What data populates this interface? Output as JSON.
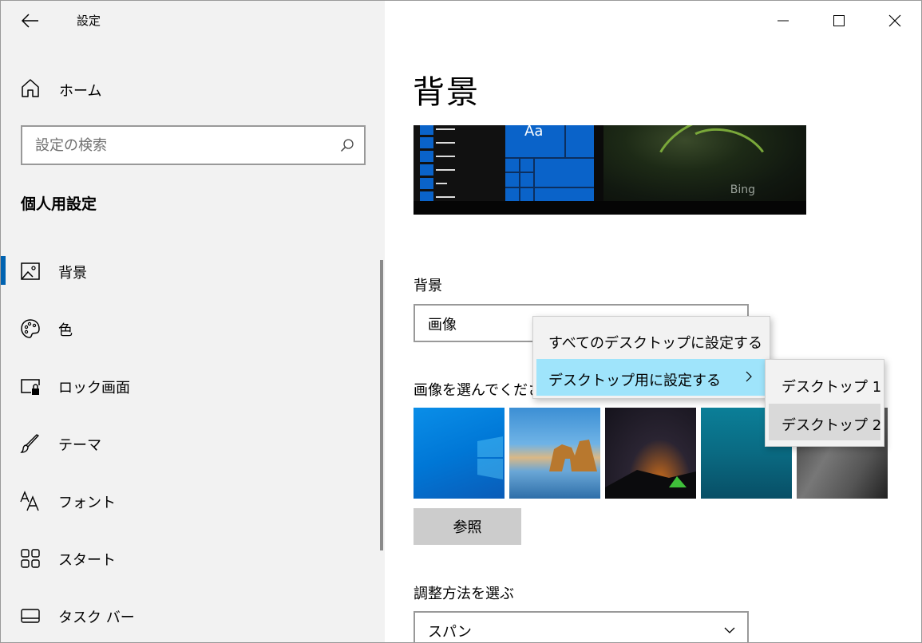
{
  "window": {
    "app_title": "設定"
  },
  "sidebar": {
    "home_label": "ホーム",
    "search_placeholder": "設定の検索",
    "section_heading": "個人用設定",
    "items": [
      {
        "label": "背景",
        "icon": "picture-icon",
        "selected": true
      },
      {
        "label": "色",
        "icon": "palette-icon",
        "selected": false
      },
      {
        "label": "ロック画面",
        "icon": "lock-screen-icon",
        "selected": false
      },
      {
        "label": "テーマ",
        "icon": "brush-icon",
        "selected": false
      },
      {
        "label": "フォント",
        "icon": "font-icon",
        "selected": false
      },
      {
        "label": "スタート",
        "icon": "start-grid-icon",
        "selected": false
      },
      {
        "label": "タスク バー",
        "icon": "taskbar-icon",
        "selected": false
      }
    ]
  },
  "main": {
    "page_title": "背景",
    "preview": {
      "sample_text": "Aa",
      "watermark": "Bing"
    },
    "background_label": "背景",
    "background_value": "画像",
    "choose_image_label": "画像を選んでくださ",
    "browse_label": "参照",
    "fit_label": "調整方法を選ぶ",
    "fit_value": "スパン"
  },
  "context_menu": {
    "items": [
      {
        "label": "すべてのデスクトップに設定する",
        "highlighted": false
      },
      {
        "label": "デスクトップ用に設定する",
        "highlighted": true
      }
    ],
    "submenu": [
      {
        "label": "デスクトップ 1",
        "highlighted": false
      },
      {
        "label": "デスクトップ 2",
        "highlighted": true
      }
    ]
  },
  "colors": {
    "accent": "#0063b1",
    "menu_highlight": "#9fe4fb",
    "sidebar_bg": "#f2f2f2"
  }
}
